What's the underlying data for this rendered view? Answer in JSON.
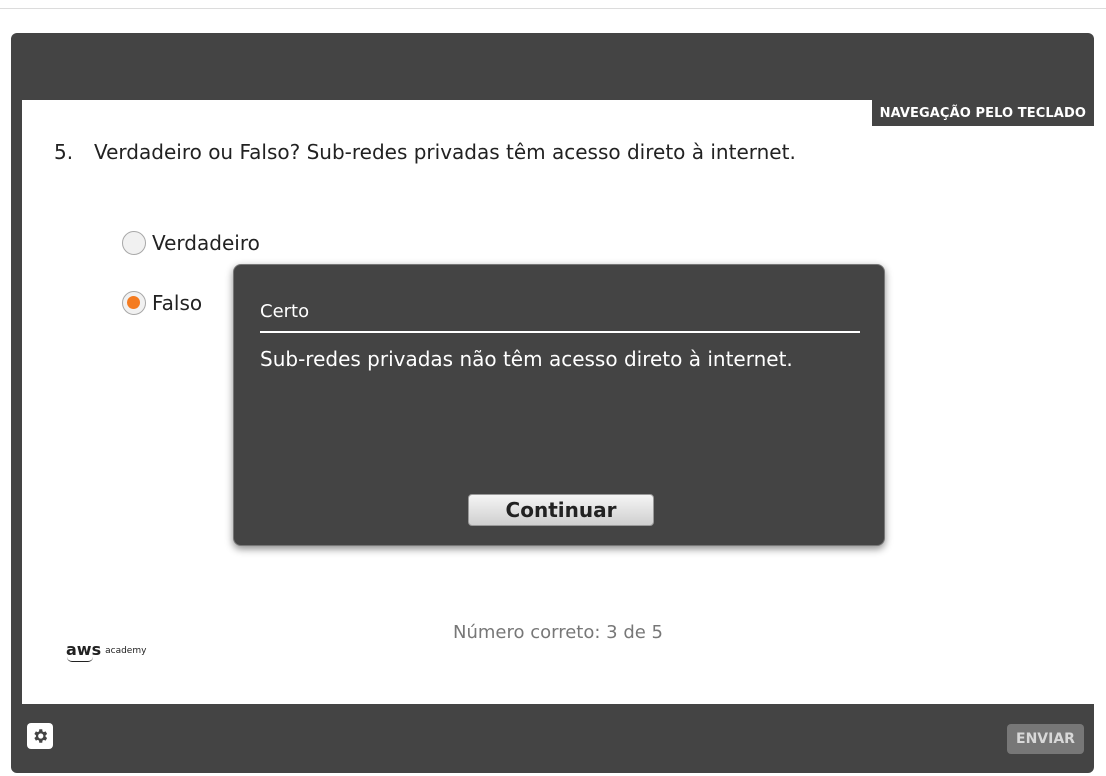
{
  "toolbar": {
    "keyboard_nav_label": "NAVEGAÇÃO PELO TECLADO"
  },
  "question": {
    "number": "5.",
    "text": "Verdadeiro ou Falso? Sub-redes privadas têm acesso direto à internet.",
    "options": [
      {
        "label": "Verdadeiro",
        "selected": false
      },
      {
        "label": "Falso",
        "selected": true
      }
    ]
  },
  "feedback": {
    "title": "Certo",
    "message": "Sub-redes privadas não têm acesso direto à internet.",
    "continue_label": "Continuar"
  },
  "score": {
    "text": "Número correto: 3 de 5"
  },
  "logo": {
    "brand": "aws",
    "product": "academy"
  },
  "footer": {
    "settings_icon": "gear-icon",
    "submit_label": "ENVIAR"
  },
  "colors": {
    "player_bg": "#444444",
    "radio_selected": "#f47b20",
    "submit_disabled": "#777777"
  }
}
